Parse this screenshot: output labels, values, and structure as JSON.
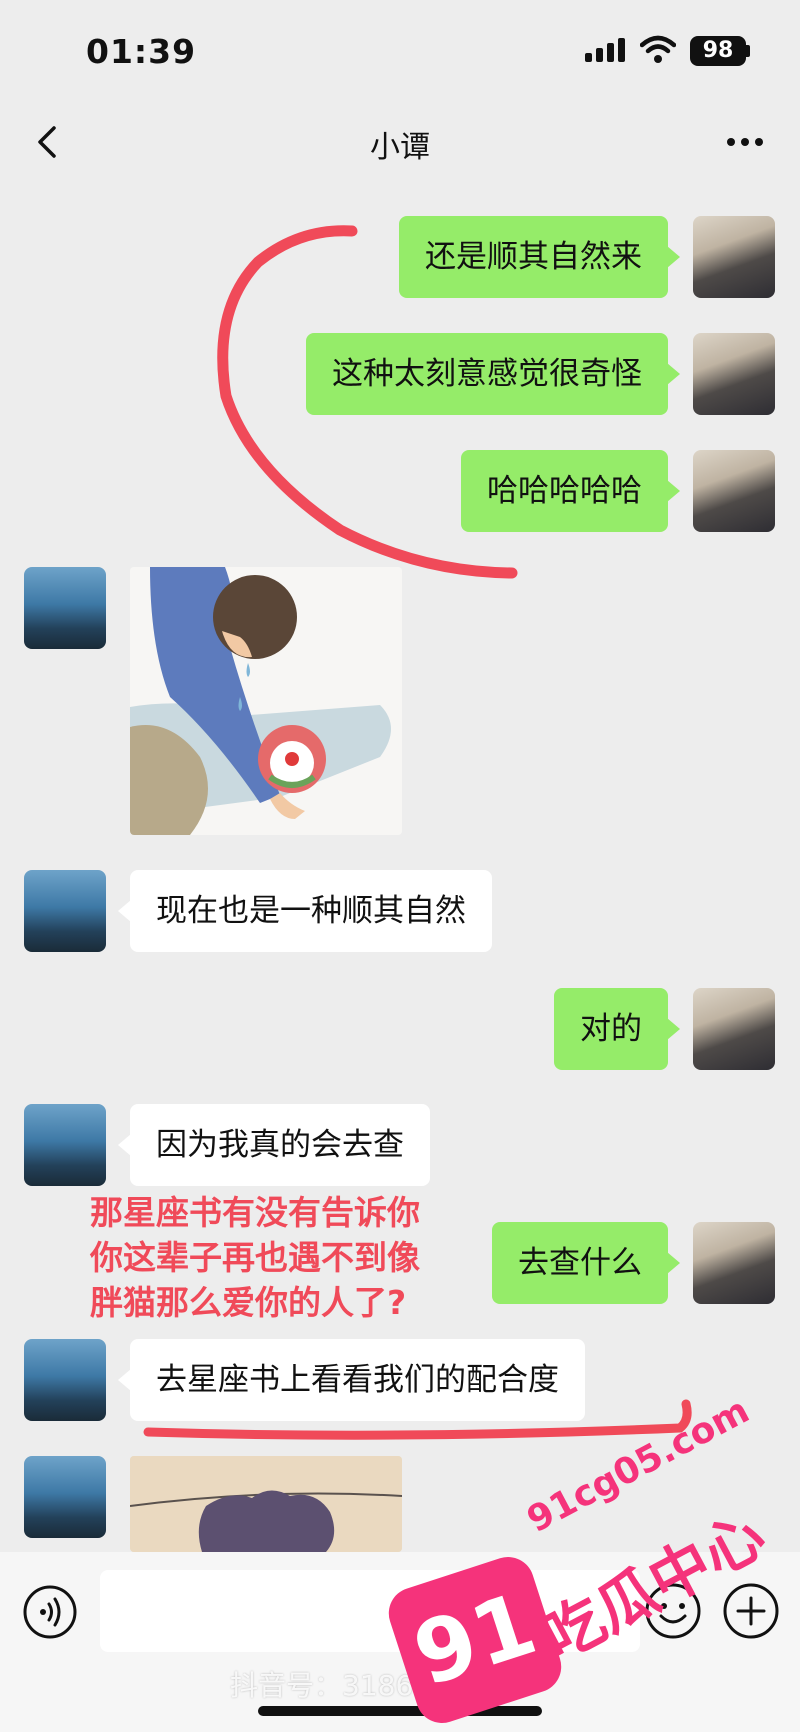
{
  "status_bar": {
    "time": "01:39",
    "battery": "98"
  },
  "nav": {
    "title": "小谭"
  },
  "messages": [
    {
      "side": "right",
      "type": "text",
      "text": "还是顺其自然来"
    },
    {
      "side": "right",
      "type": "text",
      "text": "这种太刻意感觉很奇怪"
    },
    {
      "side": "right",
      "type": "text",
      "text": "哈哈哈哈哈"
    },
    {
      "side": "left",
      "type": "sticker",
      "icon": "sticker-crying-boy-clown"
    },
    {
      "side": "left",
      "type": "text",
      "text": "现在也是一种顺其自然"
    },
    {
      "side": "right",
      "type": "text",
      "text": "对的"
    },
    {
      "side": "left",
      "type": "text",
      "text": "因为我真的会去查"
    },
    {
      "side": "right",
      "type": "text",
      "text": "去查什么"
    },
    {
      "side": "left",
      "type": "text",
      "text": "去星座书上看看我们的配合度"
    },
    {
      "side": "left",
      "type": "sticker",
      "icon": "sticker-partial"
    }
  ],
  "overlay_caption": [
    "那星座书有没有告诉你",
    "你这辈子再也遇不到像",
    "胖猫那么爱你的人了?"
  ],
  "input_bar": {
    "voice_icon": "voice-icon",
    "emoji_icon": "emoji-icon",
    "plus_icon": "plus-icon"
  },
  "watermarks": {
    "tiktok": "抖音号：31865 8 87",
    "badge": "91",
    "site": "91cg05.com",
    "name": "吃瓜中心"
  },
  "colors": {
    "bubble_self": "#95ec69",
    "bubble_other": "#ffffff",
    "annotation": "#f04a59",
    "watermark": "#f5337b"
  }
}
